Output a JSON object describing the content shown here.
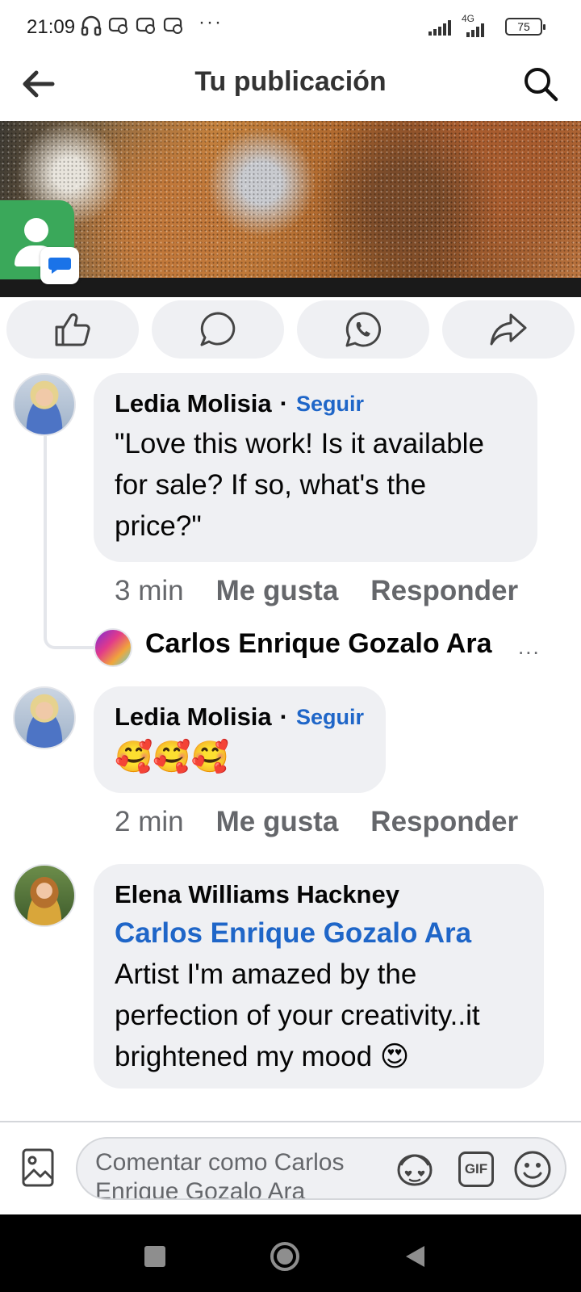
{
  "status_bar": {
    "time": "21:09",
    "network": "4G",
    "battery": "75"
  },
  "header": {
    "title": "Tu publicación",
    "back_icon": "arrow-left-icon",
    "search_icon": "search-icon"
  },
  "actions": [
    {
      "name": "like",
      "icon": "thumbs-up-icon"
    },
    {
      "name": "comment",
      "icon": "comment-icon"
    },
    {
      "name": "whatsapp",
      "icon": "whatsapp-icon"
    },
    {
      "name": "share",
      "icon": "share-icon"
    }
  ],
  "comments": [
    {
      "author": "Ledia Molisia",
      "separator": "·",
      "follow": "Seguir",
      "text": "\"Love this work! Is it available for sale? If so, what's the price?\"",
      "time": "3 min",
      "like": "Me gusta",
      "reply": "Responder",
      "reply_preview": {
        "author": "Carlos Enrique Gozalo Ara",
        "more": "..."
      }
    },
    {
      "author": "Ledia Molisia",
      "separator": "·",
      "follow": "Seguir",
      "text": "🥰🥰🥰",
      "time": "2 min",
      "like": "Me gusta",
      "reply": "Responder"
    },
    {
      "author": "Elena Williams Hackney",
      "mention": "Carlos Enrique Gozalo Ara",
      "text": "Artist I'm amazed by the perfection of your creativity..it brightened my mood 😍"
    }
  ],
  "composer": {
    "placeholder": "Comentar como Carlos Enrique Gozalo Ara",
    "gif_label": "GIF"
  },
  "colors": {
    "link_blue": "#1f66c8",
    "bubble_bg": "#eff0f3",
    "meta_grey": "#65676b",
    "contact_green": "#3aa85a"
  }
}
